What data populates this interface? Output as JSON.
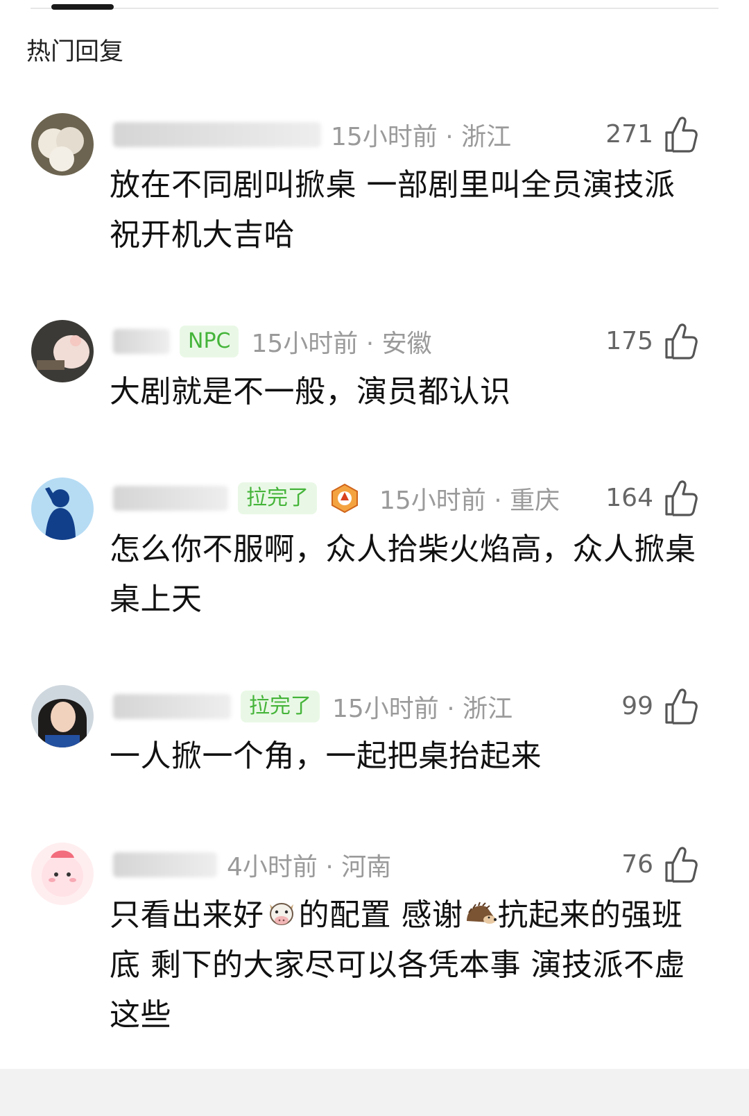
{
  "section_title": "热门回复",
  "comments": [
    {
      "username": "",
      "badge": "",
      "time_location": "15小时前 · 浙江",
      "likes": "271",
      "text": "放在不同剧叫掀桌 一部剧里叫全员演技派 祝开机大吉哈"
    },
    {
      "username": "",
      "badge": "NPC",
      "time_location": "15小时前 · 安徽",
      "likes": "175",
      "text": "大剧就是不一般，演员都认识"
    },
    {
      "username": "",
      "badge": "拉完了",
      "time_location": "15小时前 · 重庆",
      "likes": "164",
      "text": "怎么你不服啊，众人拾柴火焰高，众人掀桌桌上天"
    },
    {
      "username": "",
      "badge": "拉完了",
      "time_location": "15小时前 · 浙江",
      "likes": "99",
      "text": "一人掀一个角，一起把桌抬起来"
    },
    {
      "username": "",
      "badge": "",
      "time_location": "4小时前 · 河南",
      "likes": "76",
      "text_part1": "只看出来好",
      "text_part2": "的配置 感谢",
      "text_part3": "抗起来的强班底 剩下的大家尽可以各凭本事 演技派不虚这些",
      "emoji1": "cow-face-emoji",
      "emoji2": "hedgehog-emoji"
    }
  ],
  "colors": {
    "badge_bg": "#e9f8e6",
    "badge_text": "#45b43a",
    "meta_text": "#9a9a9a"
  },
  "icons": {
    "like": "thumbs-up-icon",
    "medal": "phoenix-medal-icon"
  }
}
